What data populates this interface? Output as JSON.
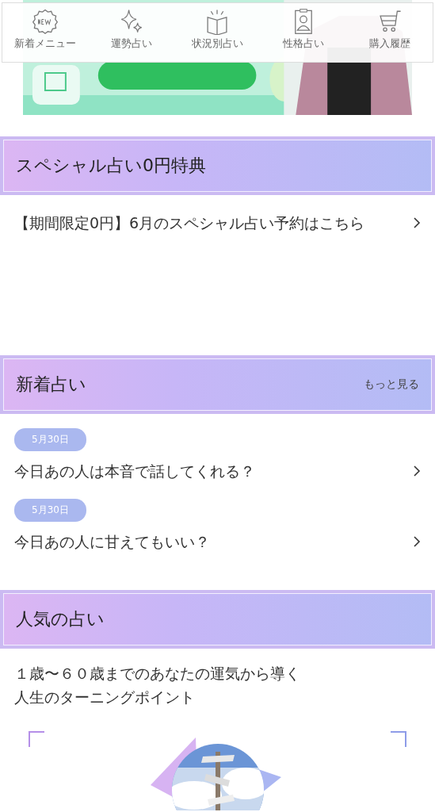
{
  "nav": [
    {
      "kind": "new",
      "label": "新着メニュー"
    },
    {
      "kind": "sparkle",
      "label": "運勢占い"
    },
    {
      "kind": "book",
      "label": "状況別占い"
    },
    {
      "kind": "badge",
      "label": "性格占い"
    },
    {
      "kind": "cart",
      "label": "購入履歴"
    }
  ],
  "special": {
    "title": "スペシャル占い0円特典",
    "items": [
      {
        "title": "【期間限定0円】6月のスペシャル占い予約はこちら"
      }
    ]
  },
  "new_fortunes": {
    "title": "新着占い",
    "more": "もっと見る",
    "items": [
      {
        "date": "5月30日",
        "title": "今日あの人は本音で話してくれる？"
      },
      {
        "date": "5月30日",
        "title": "今日あの人に甘えてもいい？"
      }
    ]
  },
  "popular": {
    "title": "人気の占い",
    "description_lines": [
      "１歳〜６０歳までのあなたの運気から導く",
      "人生のターニングポイント"
    ]
  }
}
